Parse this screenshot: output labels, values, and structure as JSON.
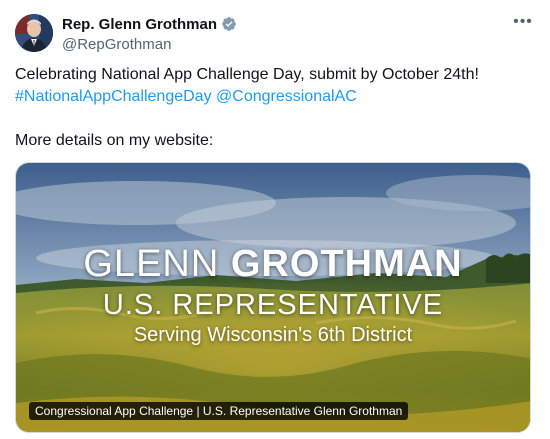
{
  "author": {
    "name": "Rep. Glenn Grothman",
    "handle": "@RepGrothman",
    "avatar_icon": "portrait-avatar",
    "verified_icon": "verified-badge-icon"
  },
  "more_icon": "more-options-icon",
  "more_glyph": "•••",
  "tweet": {
    "line1": "Celebrating National App Challenge Day, submit by October 24th!",
    "hashtag": "#NationalAppChallengeDay",
    "mention": "@CongressionalAC",
    "line3": "More details on my website:"
  },
  "media": {
    "title_first": "GLENN",
    "title_last": "GROTHMAN",
    "subtitle": "U.S. REPRESENTATIVE",
    "tagline": "Serving Wisconsin's 6th District",
    "caption": "Congressional App Challenge | U.S. Representative Glenn Grothman"
  },
  "colors": {
    "link": "#1d9bf0",
    "secondary_text": "#536471",
    "verified": "#829aab"
  }
}
